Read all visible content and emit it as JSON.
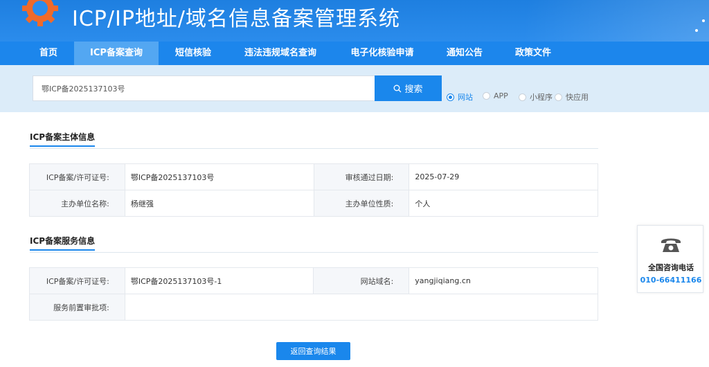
{
  "header": {
    "title": "ICP/IP地址/域名信息备案管理系统",
    "logo_icon": "gear-logo-icon"
  },
  "nav": {
    "items": [
      {
        "label": "首页",
        "active": false
      },
      {
        "label": "ICP备案查询",
        "active": true
      },
      {
        "label": "短信核验",
        "active": false
      },
      {
        "label": "违法违规域名查询",
        "active": false
      },
      {
        "label": "电子化核验申请",
        "active": false
      },
      {
        "label": "通知公告",
        "active": false
      },
      {
        "label": "政策文件",
        "active": false
      }
    ]
  },
  "search": {
    "value": "鄂ICP备2025137103号",
    "button_label": "搜索",
    "button_icon": "search-icon",
    "types": [
      {
        "label": "网站",
        "checked": true
      },
      {
        "label": "APP",
        "checked": false
      },
      {
        "label": "小程序",
        "checked": false
      },
      {
        "label": "快应用",
        "checked": false
      }
    ]
  },
  "subject_info": {
    "title": "ICP备案主体信息",
    "rows": [
      [
        {
          "label": "ICP备案/许可证号:",
          "value": "鄂ICP备2025137103号"
        },
        {
          "label": "审核通过日期:",
          "value": "2025-07-29"
        }
      ],
      [
        {
          "label": "主办单位名称:",
          "value": "杨继强"
        },
        {
          "label": "主办单位性质:",
          "value": "个人"
        }
      ]
    ]
  },
  "service_info": {
    "title": "ICP备案服务信息",
    "license_label": "ICP备案/许可证号:",
    "license_value": "鄂ICP备2025137103号-1",
    "domain_label": "网站域名:",
    "domain_value": "yangjiqiang.cn",
    "approval_label": "服务前置审批项:",
    "approval_value": ""
  },
  "contact": {
    "icon": "telephone-icon",
    "title": "全国咨询电话",
    "number": "010-66411166"
  },
  "back_button_label": "返回查询结果",
  "colors": {
    "primary": "#1a87ec",
    "nav_bg": "#1c86ec",
    "nav_active": "#53a7f2",
    "search_band": "#dcecf9"
  }
}
